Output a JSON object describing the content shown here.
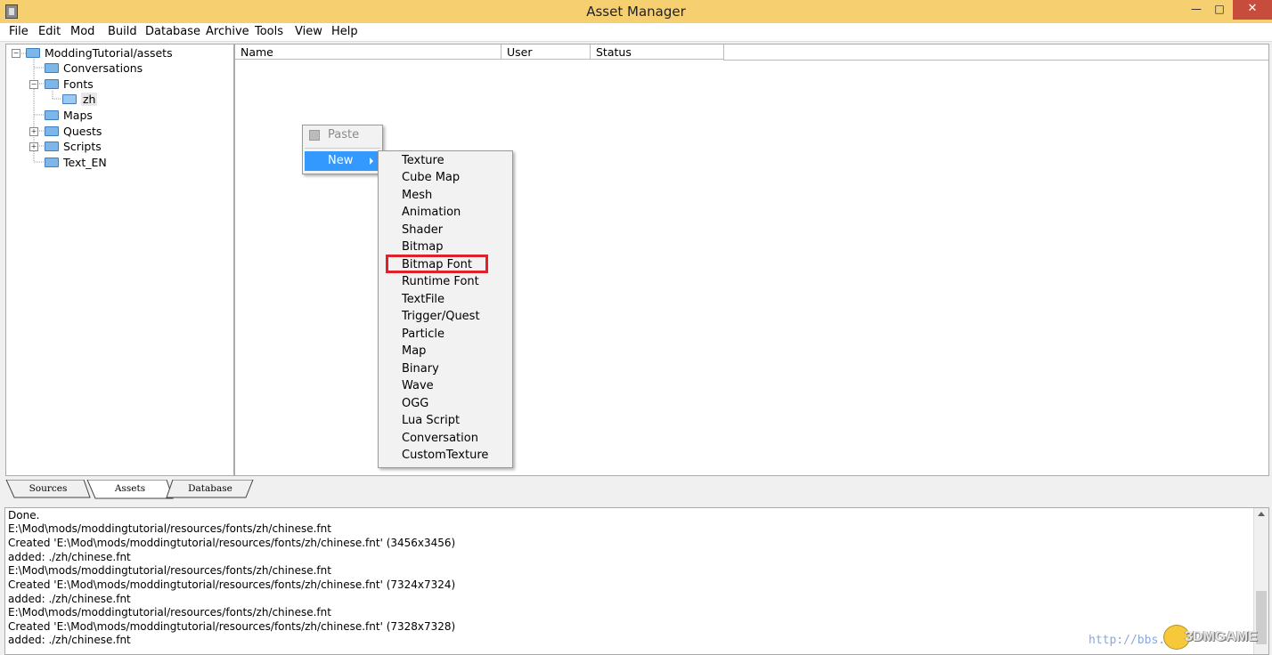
{
  "window": {
    "title": "Asset Manager",
    "min_glyph": "—",
    "max_glyph": "□",
    "close_glyph": "✕"
  },
  "menubar": {
    "items": [
      "File",
      "Edit",
      "Mod",
      "Build",
      "Database",
      "Archive",
      "Tools",
      "View",
      "Help"
    ]
  },
  "tree": {
    "root": "ModdingTutorial/assets",
    "items": [
      "Conversations",
      "Fonts",
      "zh",
      "Maps",
      "Quests",
      "Scripts",
      "Text_EN"
    ]
  },
  "list": {
    "columns": [
      "Name",
      "User",
      "Status"
    ]
  },
  "context_menu": {
    "paste_label": "Paste",
    "new_label": "New"
  },
  "new_submenu": {
    "items": [
      "Texture",
      "Cube Map",
      "Mesh",
      "Animation",
      "Shader",
      "Bitmap",
      "Bitmap Font",
      "Runtime Font",
      "TextFile",
      "Trigger/Quest",
      "Particle",
      "Map",
      "Binary",
      "Wave",
      "OGG",
      "Lua Script",
      "Conversation",
      "CustomTexture"
    ],
    "highlighted": "Bitmap Font",
    "highlight_color": "#e0202a"
  },
  "tabs": [
    "Sources",
    "Assets",
    "Database"
  ],
  "log": {
    "lines": [
      "Done.",
      "E:\\Mod\\mods/moddingtutorial/resources/fonts/zh/chinese.fnt",
      "Created 'E:\\Mod\\mods/moddingtutorial/resources/fonts/zh/chinese.fnt' (3456x3456)",
      "added: ./zh/chinese.fnt",
      "E:\\Mod\\mods/moddingtutorial/resources/fonts/zh/chinese.fnt",
      "Created 'E:\\Mod\\mods/moddingtutorial/resources/fonts/zh/chinese.fnt' (7324x7324)",
      "added: ./zh/chinese.fnt",
      "E:\\Mod\\mods/moddingtutorial/resources/fonts/zh/chinese.fnt",
      "Created 'E:\\Mod\\mods/moddingtutorial/resources/fonts/zh/chinese.fnt' (7328x7328)",
      "added: ./zh/chinese.fnt"
    ]
  },
  "watermark": {
    "url": "http://bbs.",
    "logo": "3DMGAME"
  },
  "colors": {
    "titlebar": "#f5cf70",
    "selection": "#3399ff",
    "close": "#c74c3c"
  }
}
